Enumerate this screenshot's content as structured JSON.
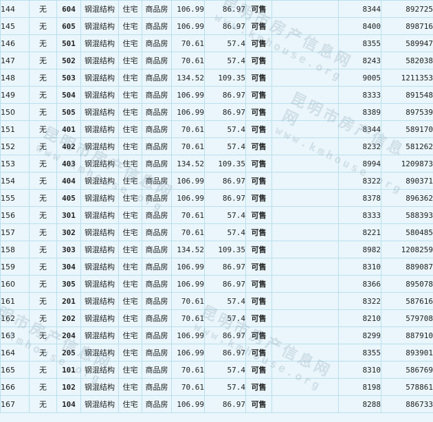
{
  "rows": [
    {
      "idx": "144",
      "balcony": "无",
      "room": "604",
      "structure": "钢混结构",
      "use": "住宅",
      "type": "商品房",
      "build_area": "106.99",
      "inner_area": "86.97",
      "status": "可售",
      "unit_price": "8344",
      "total": "892725"
    },
    {
      "idx": "145",
      "balcony": "无",
      "room": "605",
      "structure": "钢混结构",
      "use": "住宅",
      "type": "商品房",
      "build_area": "106.99",
      "inner_area": "86.97",
      "status": "可售",
      "unit_price": "8400",
      "total": "898716"
    },
    {
      "idx": "146",
      "balcony": "无",
      "room": "501",
      "structure": "钢混结构",
      "use": "住宅",
      "type": "商品房",
      "build_area": "70.61",
      "inner_area": "57.4",
      "status": "可售",
      "unit_price": "8355",
      "total": "589947"
    },
    {
      "idx": "147",
      "balcony": "无",
      "room": "502",
      "structure": "钢混结构",
      "use": "住宅",
      "type": "商品房",
      "build_area": "70.61",
      "inner_area": "57.4",
      "status": "可售",
      "unit_price": "8243",
      "total": "582038"
    },
    {
      "idx": "148",
      "balcony": "无",
      "room": "503",
      "structure": "钢混结构",
      "use": "住宅",
      "type": "商品房",
      "build_area": "134.52",
      "inner_area": "109.35",
      "status": "可售",
      "unit_price": "9005",
      "total": "1211353"
    },
    {
      "idx": "149",
      "balcony": "无",
      "room": "504",
      "structure": "钢混结构",
      "use": "住宅",
      "type": "商品房",
      "build_area": "106.99",
      "inner_area": "86.97",
      "status": "可售",
      "unit_price": "8333",
      "total": "891548"
    },
    {
      "idx": "150",
      "balcony": "无",
      "room": "505",
      "structure": "钢混结构",
      "use": "住宅",
      "type": "商品房",
      "build_area": "106.99",
      "inner_area": "86.97",
      "status": "可售",
      "unit_price": "8389",
      "total": "897539"
    },
    {
      "idx": "151",
      "balcony": "无",
      "room": "401",
      "structure": "钢混结构",
      "use": "住宅",
      "type": "商品房",
      "build_area": "70.61",
      "inner_area": "57.4",
      "status": "可售",
      "unit_price": "8344",
      "total": "589170"
    },
    {
      "idx": "152",
      "balcony": "无",
      "room": "402",
      "structure": "钢混结构",
      "use": "住宅",
      "type": "商品房",
      "build_area": "70.61",
      "inner_area": "57.4",
      "status": "可售",
      "unit_price": "8232",
      "total": "581262"
    },
    {
      "idx": "153",
      "balcony": "无",
      "room": "403",
      "structure": "钢混结构",
      "use": "住宅",
      "type": "商品房",
      "build_area": "134.52",
      "inner_area": "109.35",
      "status": "可售",
      "unit_price": "8994",
      "total": "1209873"
    },
    {
      "idx": "154",
      "balcony": "无",
      "room": "404",
      "structure": "钢混结构",
      "use": "住宅",
      "type": "商品房",
      "build_area": "106.99",
      "inner_area": "86.97",
      "status": "可售",
      "unit_price": "8322",
      "total": "890371"
    },
    {
      "idx": "155",
      "balcony": "无",
      "room": "405",
      "structure": "钢混结构",
      "use": "住宅",
      "type": "商品房",
      "build_area": "106.99",
      "inner_area": "86.97",
      "status": "可售",
      "unit_price": "8378",
      "total": "896362"
    },
    {
      "idx": "156",
      "balcony": "无",
      "room": "301",
      "structure": "钢混结构",
      "use": "住宅",
      "type": "商品房",
      "build_area": "70.61",
      "inner_area": "57.4",
      "status": "可售",
      "unit_price": "8333",
      "total": "588393"
    },
    {
      "idx": "157",
      "balcony": "无",
      "room": "302",
      "structure": "钢混结构",
      "use": "住宅",
      "type": "商品房",
      "build_area": "70.61",
      "inner_area": "57.4",
      "status": "可售",
      "unit_price": "8221",
      "total": "580485"
    },
    {
      "idx": "158",
      "balcony": "无",
      "room": "303",
      "structure": "钢混结构",
      "use": "住宅",
      "type": "商品房",
      "build_area": "134.52",
      "inner_area": "109.35",
      "status": "可售",
      "unit_price": "8982",
      "total": "1208259"
    },
    {
      "idx": "159",
      "balcony": "无",
      "room": "304",
      "structure": "钢混结构",
      "use": "住宅",
      "type": "商品房",
      "build_area": "106.99",
      "inner_area": "86.97",
      "status": "可售",
      "unit_price": "8310",
      "total": "889087"
    },
    {
      "idx": "160",
      "balcony": "无",
      "room": "305",
      "structure": "钢混结构",
      "use": "住宅",
      "type": "商品房",
      "build_area": "106.99",
      "inner_area": "86.97",
      "status": "可售",
      "unit_price": "8366",
      "total": "895078"
    },
    {
      "idx": "161",
      "balcony": "无",
      "room": "201",
      "structure": "钢混结构",
      "use": "住宅",
      "type": "商品房",
      "build_area": "70.61",
      "inner_area": "57.4",
      "status": "可售",
      "unit_price": "8322",
      "total": "587616"
    },
    {
      "idx": "162",
      "balcony": "无",
      "room": "202",
      "structure": "钢混结构",
      "use": "住宅",
      "type": "商品房",
      "build_area": "70.61",
      "inner_area": "57.4",
      "status": "可售",
      "unit_price": "8210",
      "total": "579708"
    },
    {
      "idx": "163",
      "balcony": "无",
      "room": "204",
      "structure": "钢混结构",
      "use": "住宅",
      "type": "商品房",
      "build_area": "106.99",
      "inner_area": "86.97",
      "status": "可售",
      "unit_price": "8299",
      "total": "887910"
    },
    {
      "idx": "164",
      "balcony": "无",
      "room": "205",
      "structure": "钢混结构",
      "use": "住宅",
      "type": "商品房",
      "build_area": "106.99",
      "inner_area": "86.97",
      "status": "可售",
      "unit_price": "8355",
      "total": "893901"
    },
    {
      "idx": "165",
      "balcony": "无",
      "room": "101",
      "structure": "钢混结构",
      "use": "住宅",
      "type": "商品房",
      "build_area": "70.61",
      "inner_area": "57.4",
      "status": "可售",
      "unit_price": "8310",
      "total": "586769"
    },
    {
      "idx": "166",
      "balcony": "无",
      "room": "102",
      "structure": "钢混结构",
      "use": "住宅",
      "type": "商品房",
      "build_area": "70.61",
      "inner_area": "57.4",
      "status": "可售",
      "unit_price": "8198",
      "total": "578861"
    },
    {
      "idx": "167",
      "balcony": "无",
      "room": "104",
      "structure": "钢混结构",
      "use": "住宅",
      "type": "商品房",
      "build_area": "106.99",
      "inner_area": "86.97",
      "status": "可售",
      "unit_price": "8288",
      "total": "886733"
    }
  ],
  "watermark": {
    "cn": "昆明市房产信息网",
    "en": "www.kmhouse.org"
  },
  "colors": {
    "background": "#eaf6fb",
    "border": "#b9dfee",
    "room_number": "#1b2fa6",
    "status_available": "#1a7a12"
  }
}
